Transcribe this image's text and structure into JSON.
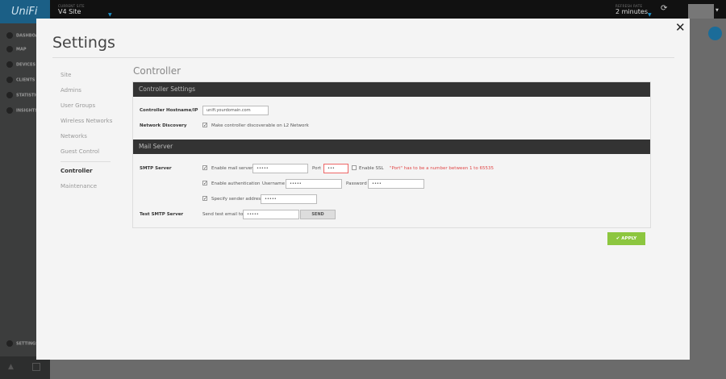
{
  "app": {
    "logo": "UniFi",
    "site_label": "CURRENT SITE",
    "site_value": "V4 Site",
    "refresh_label": "REFRESH RATE",
    "refresh_value": "2 minutes"
  },
  "sidebar": {
    "items": [
      {
        "label": "DASHBOARD",
        "icon": "dashboard-icon"
      },
      {
        "label": "MAP",
        "icon": "map-pin-icon"
      },
      {
        "label": "DEVICES",
        "icon": "devices-icon"
      },
      {
        "label": "CLIENTS",
        "icon": "laptop-icon"
      },
      {
        "label": "STATISTICS",
        "icon": "line-chart-icon"
      },
      {
        "label": "INSIGHTS",
        "icon": "bar-chart-icon"
      }
    ],
    "settings": "SETTINGS"
  },
  "modal": {
    "title": "Settings",
    "close": "✕",
    "nav": [
      "Site",
      "Admins",
      "User Groups",
      "Wireless Networks",
      "Networks",
      "Guest Control",
      "Controller",
      "Maintenance"
    ],
    "active_nav": "Controller",
    "section_title": "Controller",
    "controller_settings": {
      "header": "Controller Settings",
      "hostname_label": "Controller Hostname/IP",
      "hostname_value": "unifi.yourdomain.com",
      "discovery_label": "Network Discovery",
      "discovery_text": "Make controller discoverable on L2 Network",
      "discovery_checked": true
    },
    "mail_server": {
      "header": "Mail Server",
      "smtp_label": "SMTP Server",
      "enable_mail": "Enable mail server",
      "mail_server_value": "•••••",
      "port_label": "Port",
      "port_value": "•••",
      "enable_ssl": "Enable SSL",
      "ssl_checked": false,
      "port_error": "\"Port\" has to be a number between 1 to 65535",
      "enable_auth": "Enable authentication",
      "username_label": "Username",
      "username_value": "•••••",
      "password_label": "Password",
      "password_value": "••••",
      "sender_label": "Specify sender address",
      "sender_value": "•••••",
      "test_label": "Test SMTP Server",
      "send_test_label": "Send test email to",
      "test_value": "•••••",
      "send_button": "SEND"
    },
    "apply_button": "APPLY"
  },
  "colors": {
    "accent": "#1b5f86",
    "apply": "#8cc63f",
    "error": "#e04848",
    "header": "#333333"
  }
}
